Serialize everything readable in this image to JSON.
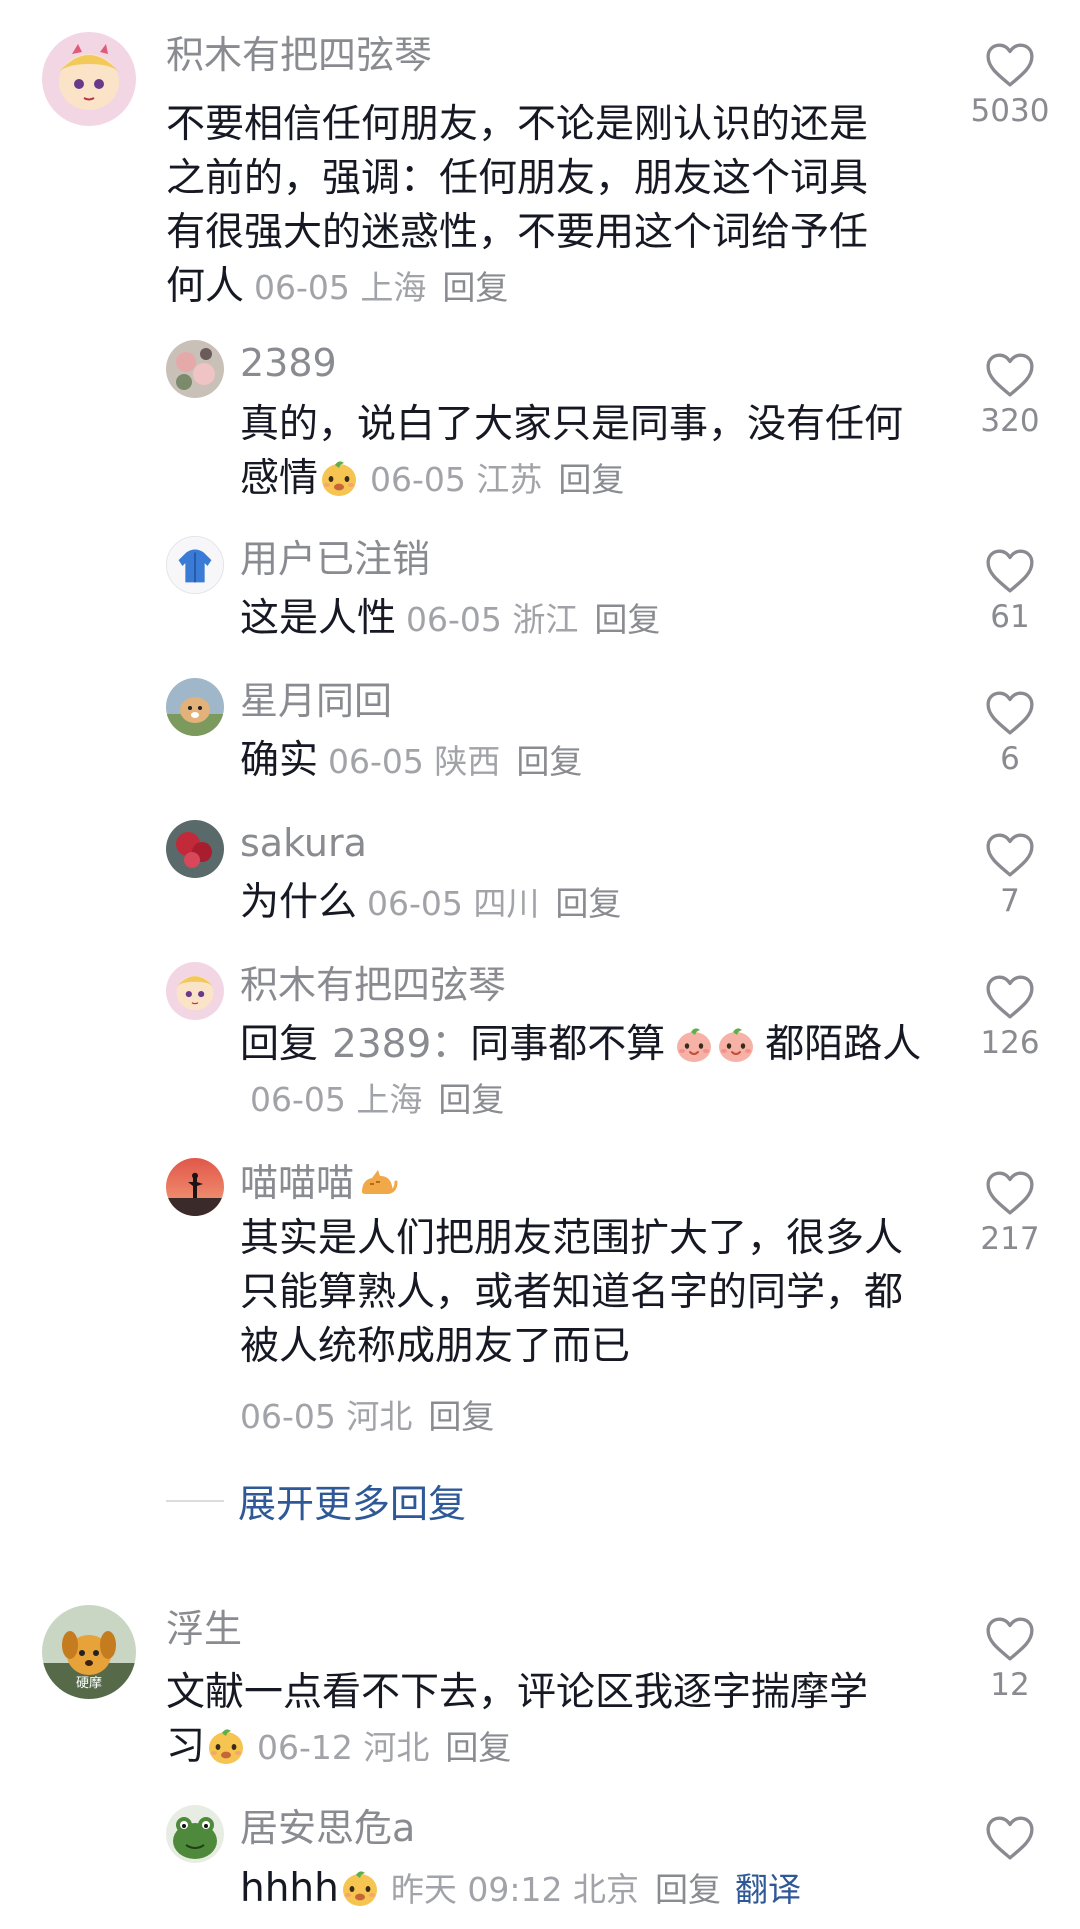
{
  "comments": [
    {
      "name": "积木有把四弦琴",
      "text": "不要相信任何朋友，不论是刚认识的还是之前的，强调：任何朋友，朋友这个词具有很强大的迷惑性，不要用这个词给予任何人",
      "date_location": "06-05 上海",
      "reply_label": "回复",
      "likes": "5030",
      "replies": [
        {
          "name": "2389",
          "text": "真的，说白了大家只是同事，没有任何感情",
          "date_location": "06-05 江苏",
          "reply_label": "回复",
          "likes": "320"
        },
        {
          "name": "用户已注销",
          "text": "这是人性",
          "date_location": "06-05 浙江",
          "reply_label": "回复",
          "likes": "61"
        },
        {
          "name": "星月同回",
          "text": "确实",
          "date_location": "06-05 陕西",
          "reply_label": "回复",
          "likes": "6"
        },
        {
          "name": "sakura",
          "text": "为什么",
          "date_location": "06-05 四川",
          "reply_label": "回复",
          "likes": "7"
        },
        {
          "name": "积木有把四弦琴",
          "reply_prefix": "回复",
          "reply_target": "2389：",
          "text_a": "同事都不算",
          "text_b": "都陌路人",
          "date_location": "06-05 上海",
          "reply_label": "回复",
          "likes": "126"
        },
        {
          "name": "喵喵喵",
          "text": "其实是人们把朋友范围扩大了，很多人只能算熟人，或者知道名字的同学，都被人统称成朋友了而已",
          "date_location": "06-05 河北",
          "reply_label": "回复",
          "likes": "217"
        }
      ],
      "expand_label": "展开更多回复"
    },
    {
      "name": "浮生",
      "avatar_text": "硬摩",
      "text": "文献一点看不下去，评论区我逐字揣摩学习",
      "date_location": "06-12 河北",
      "reply_label": "回复",
      "likes": "12",
      "replies": [
        {
          "name": "居安思危a",
          "text": "hhhh",
          "date_location": "昨天 09:12 北京",
          "reply_label": "回复",
          "translate_label": "翻译"
        }
      ]
    }
  ]
}
